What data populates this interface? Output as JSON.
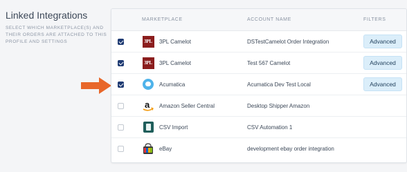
{
  "section": {
    "title": "Linked Integrations",
    "description": "SELECT WHICH MARKETPLACE(S) AND THEIR ORDERS ARE ATTACHED TO THIS PROFILE AND SETTINGS"
  },
  "table": {
    "headers": {
      "marketplace": "MARKETPLACE",
      "account_name": "ACCOUNT NAME",
      "filters": "FILTERS"
    },
    "rows": [
      {
        "checked": true,
        "logo": "3pl-camelot-logo",
        "marketplace": "3PL Camelot",
        "account": "DSTestCamelot Order Integration",
        "filter_label": "Advanced"
      },
      {
        "checked": true,
        "logo": "3pl-camelot-logo",
        "marketplace": "3PL Camelot",
        "account": "Test 567 Camelot",
        "filter_label": "Advanced"
      },
      {
        "checked": true,
        "logo": "acumatica-logo",
        "marketplace": "Acumatica",
        "account": "Acumatica Dev Test Local",
        "filter_label": "Advanced"
      },
      {
        "checked": false,
        "logo": "amazon-logo",
        "marketplace": "Amazon Seller Central",
        "account": "Desktop Shipper Amazon",
        "filter_label": ""
      },
      {
        "checked": false,
        "logo": "csv-import-logo",
        "marketplace": "CSV Import",
        "account": "CSV Automation 1",
        "filter_label": ""
      },
      {
        "checked": false,
        "logo": "ebay-logo",
        "marketplace": "eBay",
        "account": "development ebay order integration",
        "filter_label": ""
      }
    ]
  },
  "logos": {
    "three_pl_text": "3PL"
  },
  "colors": {
    "arrow": "#e8672a",
    "checkbox_checked": "#1f3b73",
    "button_bg": "#dbeefa"
  }
}
